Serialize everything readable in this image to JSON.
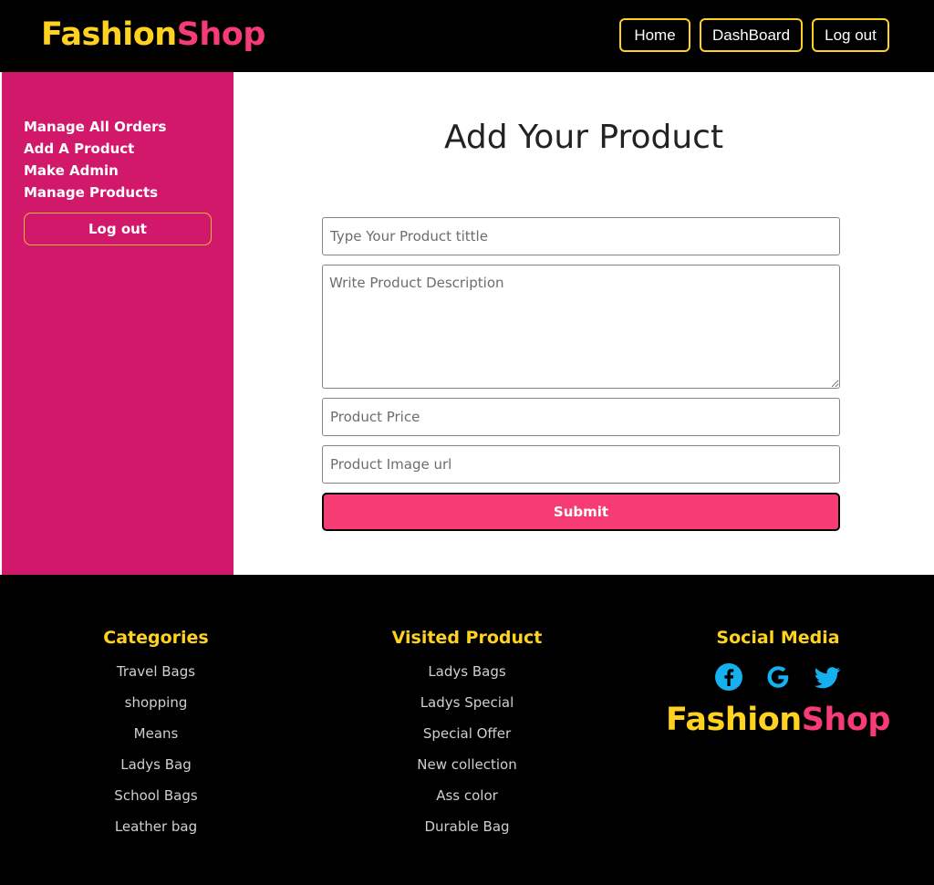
{
  "header": {
    "brand_part1": "Fashion",
    "brand_part2": "Shop",
    "nav": [
      "Home",
      "DashBoard",
      "Log out"
    ]
  },
  "sidebar": {
    "links": [
      "Manage All Orders",
      "Add A Product",
      "Make Admin",
      "Manage Products"
    ],
    "logout_label": "Log out"
  },
  "form": {
    "title": "Add Your Product",
    "title_placeholder": "Type Your Product tittle",
    "description_placeholder": "Write Product Description",
    "price_placeholder": "Product Price",
    "image_placeholder": "Product Image url",
    "submit_label": "Submit"
  },
  "footer": {
    "categories": {
      "heading": "Categories",
      "items": [
        "Travel Bags",
        "shopping",
        "Means",
        "Ladys Bag",
        "School Bags",
        "Leather bag"
      ]
    },
    "visited": {
      "heading": "Visited Product",
      "items": [
        "Ladys Bags",
        "Ladys Special",
        "Special Offer",
        "New collection",
        "Ass color",
        "Durable Bag"
      ]
    },
    "social": {
      "heading": "Social Media",
      "icons": [
        "facebook-icon",
        "google-icon",
        "twitter-icon"
      ],
      "brand_part1": "Fashion",
      "brand_part2": "Shop"
    }
  },
  "colors": {
    "brand_yellow": "#ffd21f",
    "brand_pink": "#f63b75",
    "sidebar_bg": "#d1186b",
    "social_icon": "#15b0ee"
  }
}
